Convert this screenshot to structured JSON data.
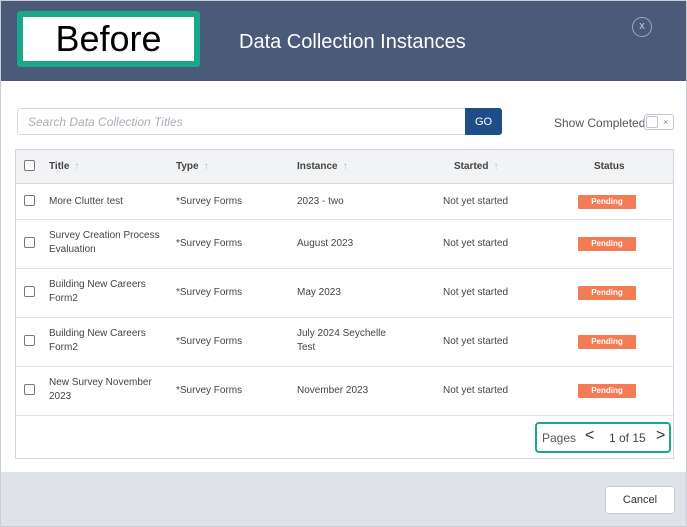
{
  "badge": {
    "label": "Before"
  },
  "header": {
    "title": "Data Collection Instances",
    "close_label": "x"
  },
  "search": {
    "placeholder": "Search Data Collection Titles",
    "go_label": "GO"
  },
  "show_completed": {
    "label": "Show Completed",
    "toggle_off": "×"
  },
  "table": {
    "columns": {
      "title": "Title",
      "type": "Type",
      "instance": "Instance",
      "started": "Started",
      "status": "Status"
    },
    "sort_arrow": "↑",
    "rows": [
      {
        "title": [
          "More Clutter test"
        ],
        "type": "*Survey Forms",
        "instance": [
          "2023 - two"
        ],
        "started": "Not yet started",
        "status": "Pending"
      },
      {
        "title": [
          "Survey Creation Process",
          "Evaluation"
        ],
        "type": "*Survey Forms",
        "instance": [
          "August 2023"
        ],
        "started": "Not yet started",
        "status": "Pending"
      },
      {
        "title": [
          "Building New Careers",
          "Form2"
        ],
        "type": "*Survey Forms",
        "instance": [
          "May 2023"
        ],
        "started": "Not yet started",
        "status": "Pending"
      },
      {
        "title": [
          "Building New Careers",
          "Form2"
        ],
        "type": "*Survey Forms",
        "instance": [
          "July 2024 Seychelle",
          "Test"
        ],
        "started": "Not yet started",
        "status": "Pending"
      },
      {
        "title": [
          "New Survey November",
          "2023"
        ],
        "type": "*Survey Forms",
        "instance": [
          "November 2023"
        ],
        "started": "Not yet started",
        "status": "Pending"
      }
    ]
  },
  "pager": {
    "label": "Pages",
    "prev": "<",
    "info": "1 of 15",
    "next": ">"
  },
  "footer": {
    "cancel_label": "Cancel"
  },
  "colors": {
    "header_bg": "#4a5a78",
    "go_bg": "#1e4d87",
    "pending": "#f47c55",
    "highlight": "#1aa88a"
  }
}
